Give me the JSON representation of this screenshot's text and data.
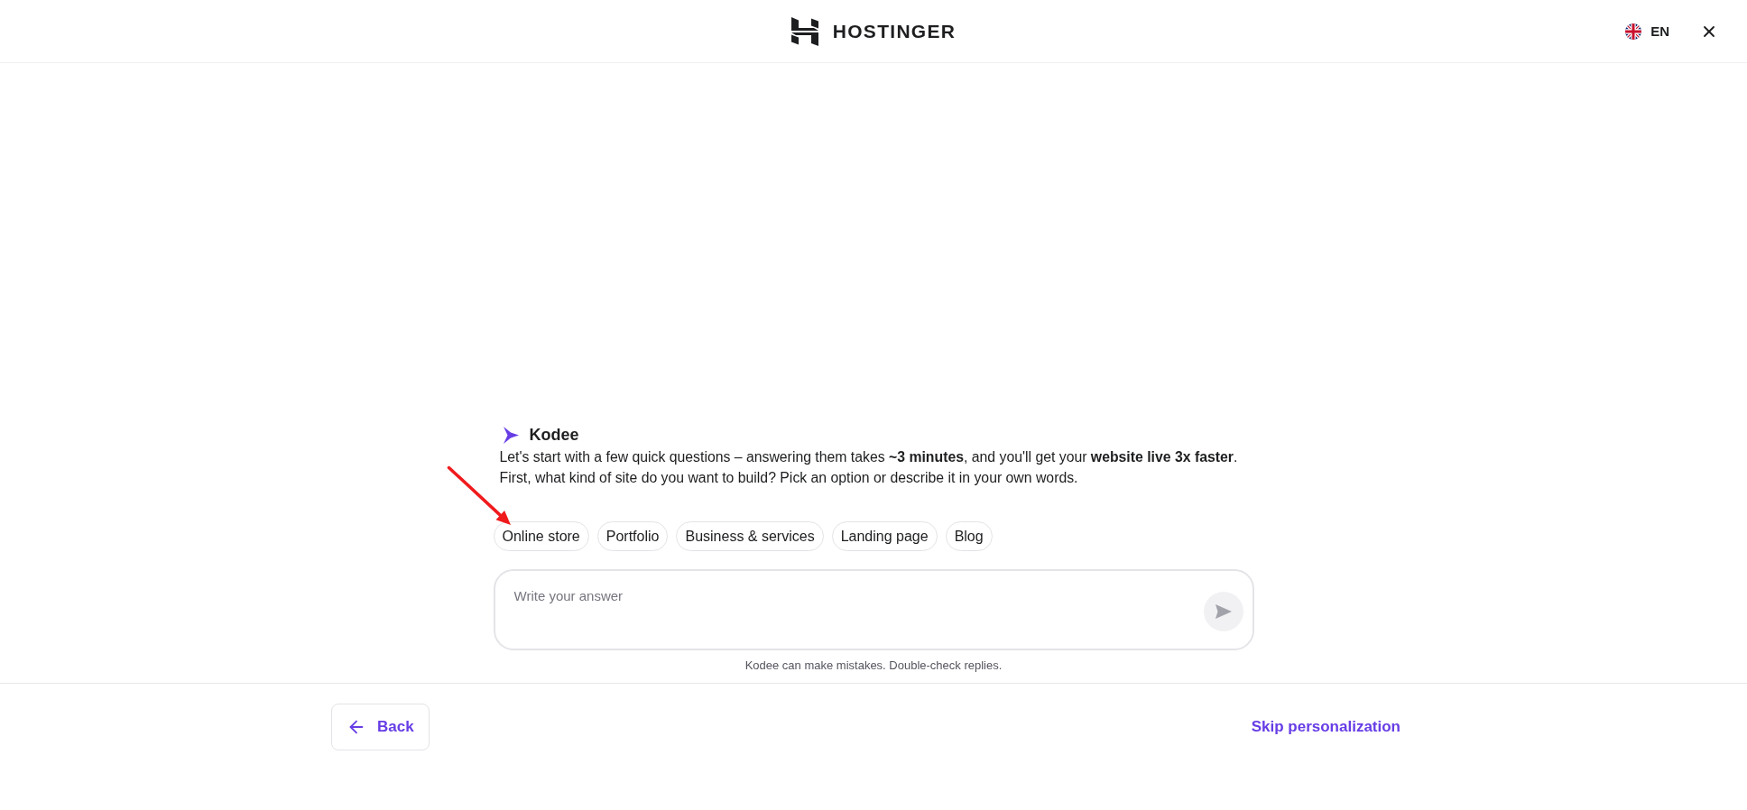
{
  "header": {
    "logo": "HOSTINGER",
    "language": "EN"
  },
  "assistant": {
    "name": "Kodee",
    "lines": [
      "Let's start with a few quick questions – answering them takes **~3 minutes**, and you'll get your **website live 3x faster**.",
      "First, what kind of site do you want to build? Pick an option or describe it in your own words."
    ]
  },
  "options": [
    "Online store",
    "Portfolio",
    "Business & services",
    "Landing page",
    "Blog"
  ],
  "answer_field": {
    "placeholder": "Write your answer"
  },
  "send_button": {
    "disabled": true
  },
  "disclaimer": "Kodee can make mistakes. Double-check replies.",
  "footer": {
    "back_button": "Back",
    "skip_link": "Skip personalization"
  }
}
